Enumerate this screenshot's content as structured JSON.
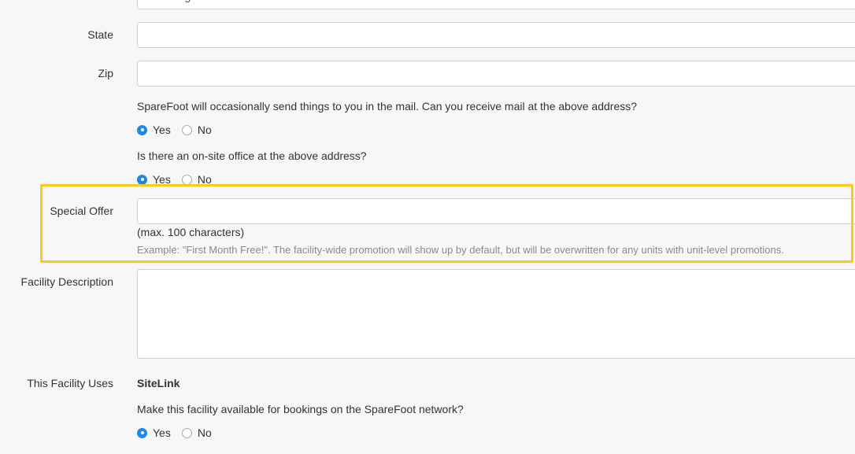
{
  "city": {
    "value": "Pittsburgh"
  },
  "state": {
    "label": "State",
    "value": ""
  },
  "zip": {
    "label": "Zip",
    "value": ""
  },
  "mail": {
    "question": "SpareFoot will occasionally send things to you in the mail. Can you receive mail at the above address?",
    "yes_label": "Yes",
    "no_label": "No",
    "selected": "Yes"
  },
  "office": {
    "question": "Is there an on-site office at the above address?",
    "yes_label": "Yes",
    "no_label": "No",
    "selected": "Yes"
  },
  "special_offer": {
    "label": "Special Offer",
    "value": "",
    "limit_note": "(max. 100 characters)",
    "example": "Example: \"First Month Free!\". The facility-wide promotion will show up by default, but will be overwritten for any units with unit-level promotions."
  },
  "description": {
    "label": "Facility Description",
    "value": ""
  },
  "software": {
    "label": "This Facility Uses",
    "value": "SiteLink"
  },
  "bookings": {
    "question": "Make this facility available for bookings on the SpareFoot network?",
    "yes_label": "Yes",
    "no_label": "No",
    "selected": "Yes"
  },
  "colors": {
    "highlight": "#f6cd1d",
    "radio_selected": "#1e88e5"
  }
}
